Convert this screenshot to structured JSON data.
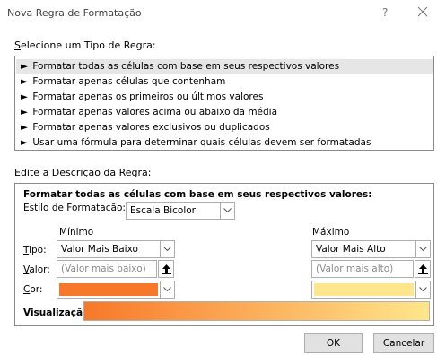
{
  "window": {
    "title": "Nova Regra de Formatação",
    "help_glyph": "?",
    "close_icon": "close-icon"
  },
  "rule_type": {
    "label_first": "S",
    "label_rest": "elecione um Tipo de Regra:",
    "arrow": "►",
    "items": [
      "Formatar todas as células com base em seus respectivos valores",
      "Formatar apenas células que contenham",
      "Formatar apenas os primeiros ou últimos valores",
      "Formatar apenas valores acima ou abaixo da média",
      "Formatar apenas valores exclusivos ou duplicados",
      "Usar uma fórmula para determinar quais células devem ser formatadas"
    ],
    "selected_index": 0
  },
  "description": {
    "label_first": "E",
    "label_rest": "dite a Descrição da Regra:",
    "heading": "Formatar todas as células com base em seus respectivos valores:",
    "style_label_pre": "Estilo de F",
    "style_label_u": "o",
    "style_label_post": "rmatação:",
    "style_value": "Escala Bicolor",
    "min_header": "Mínimo",
    "max_header": "Máximo",
    "type_label_u": "T",
    "type_label_rest": "ipo:",
    "value_label_u": "V",
    "value_label_rest": "alor:",
    "color_label_u": "C",
    "color_label_rest": "or:",
    "min_type": "Valor Mais Baixo",
    "max_type": "Valor Mais Alto",
    "min_value_placeholder": "(Valor mais baixo)",
    "max_value_placeholder": "(Valor mais alto)",
    "min_color": "#f8782a",
    "max_color": "#ffe68c",
    "preview_label": "Visualização:"
  },
  "footer": {
    "ok_label": "OK",
    "cancel_label": "Cancelar"
  }
}
